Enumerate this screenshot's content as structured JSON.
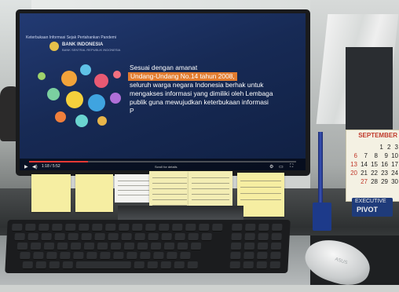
{
  "screen": {
    "window_title": "Keterbukaan Informasi Sejak Pertahankan Pandemi",
    "logo_text": "BANK INDONESIA",
    "logo_subtext": "BANK SENTRAL REPUBLIK INDONESIA",
    "slide_text": {
      "line1": "Sesuai dengan amanat",
      "highlight": "Undang-Undang No.14 tahun 2008,",
      "line3": "seluruh warga negara Indonesia berhak untuk",
      "line4": "mengakses informasi yang dimiliki oleh Lembaga",
      "line5": "publik guna mewujudkan keterbukaan informasi",
      "line6": "P"
    },
    "video_controls": {
      "time": "1:18 / 5:52",
      "scroll_hint": "Scroll for details",
      "progress": 0.22
    }
  },
  "calendar": {
    "month": "SEPTEMBER",
    "rows": [
      [
        "",
        "",
        "",
        "",
        "1",
        "2",
        "3"
      ],
      [
        "6",
        "7",
        "8",
        "9",
        "10"
      ],
      [
        "13",
        "14",
        "15",
        "16",
        "17"
      ],
      [
        "20",
        "21",
        "22",
        "23",
        "24"
      ],
      [
        "27",
        "28",
        "29",
        "30"
      ]
    ]
  },
  "executive_sign": {
    "top": "EXECUTIVE",
    "bottom": "PIVOT"
  },
  "mouse_brand": "ASUS",
  "colors": {
    "highlight": "#e27c2f",
    "screen_bg": "#172a55",
    "sticky": "#f6eea2"
  }
}
